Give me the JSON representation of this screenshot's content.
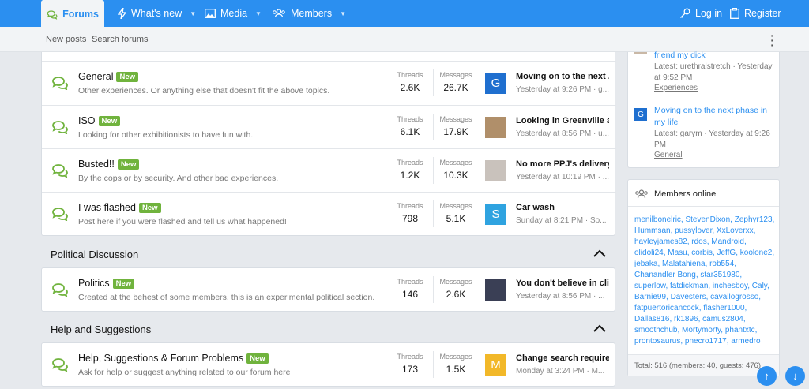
{
  "nav": {
    "forums": "Forums",
    "whats_new": "What's new",
    "media": "Media",
    "members": "Members",
    "login": "Log in",
    "register": "Register"
  },
  "subnav": {
    "new_posts": "New posts",
    "search_forums": "Search forums"
  },
  "labels": {
    "threads": "Threads",
    "messages": "Messages",
    "new_badge": "New"
  },
  "forums_block1": [
    {
      "title": "General",
      "desc": "Other experiences. Or anything else that doesn't fit the above topics.",
      "threads": "2.6K",
      "messages": "26.7K",
      "last_title": "Moving on to the next ...",
      "last_meta": "Yesterday at 9:26 PM · g...",
      "avatar_letter": "G",
      "avatar_color": "#1f6fcf"
    },
    {
      "title": "ISO",
      "desc": "Looking for other exhibitionists to have fun with.",
      "threads": "6.1K",
      "messages": "17.9K",
      "last_title": "Looking in Greenville a...",
      "last_meta": "Yesterday at 8:56 PM · u...",
      "avatar_letter": "",
      "avatar_color": "#b08f6a"
    },
    {
      "title": "Busted!!",
      "desc": "By the cops or by security. And other bad experiences.",
      "threads": "1.2K",
      "messages": "10.3K",
      "last_title": "No more PPJ's delivery ...",
      "last_meta": "Yesterday at 10:19 PM · ...",
      "avatar_letter": "",
      "avatar_color": "#c9c2bc"
    },
    {
      "title": "I was flashed",
      "desc": "Post here if you were flashed and tell us what happened!",
      "threads": "798",
      "messages": "5.1K",
      "last_title": "Car wash",
      "last_meta": "Sunday at 8:21 PM · So...",
      "avatar_letter": "S",
      "avatar_color": "#2fa3e0"
    }
  ],
  "category_political": "Political Discussion",
  "forum_politics": {
    "title": "Politics",
    "desc": "Created at the behest of some members, this is an experimental political section.",
    "threads": "146",
    "messages": "2.6K",
    "last_title": "You don't believe in cli...",
    "last_meta": "Yesterday at 8:56 PM · ...",
    "avatar_letter": "",
    "avatar_color": "#3a3f55"
  },
  "category_help": "Help and Suggestions",
  "forum_help": {
    "title": "Help, Suggestions & Forum Problems",
    "desc": "Ask for help or suggest anything related to our forum here",
    "threads": "173",
    "messages": "1.5K",
    "last_title": "Change search require...",
    "last_meta": "Monday at 3:24 PM · M...",
    "avatar_letter": "M",
    "avatar_color": "#f2b829"
  },
  "sidebar_latest": {
    "item1_title": "friend my dick",
    "item1_meta": "Latest: urethralstretch · Yesterday at 9:52 PM",
    "item1_forum": "Experiences",
    "item2_title": "Moving on to the next phase in my life",
    "item2_meta": "Latest: garym · Yesterday at 9:26 PM",
    "item2_forum": "General",
    "item2_avatar": "G"
  },
  "members_online": {
    "title": "Members online",
    "names": "menilbonelric, StevenDixon, Zephyr123, Hummsan, pussylover, XxLoverxx, hayleyjames82, rdos, Mandroid, olidoli24, Masu, corbis, JeffG, koolone2, jebaka, Malatahiena, rob554, Chanandler Bong, star351980, superlow, fatdickman, inchesboy, Caly, Barnie99, Davesters, cavallogrosso, fatpuertoricancock, flasher1000, Dallas816, rk1896, camus2804, smoothchub, Mortymorty, phantxtc, prontosaurus, pnecro1717, armedro",
    "total": "Total: 516 (members: 40, guests: 476)"
  },
  "colors": {
    "accent": "#2b8ff0",
    "badge": "#70b33d",
    "bubble": "#70b33d"
  }
}
